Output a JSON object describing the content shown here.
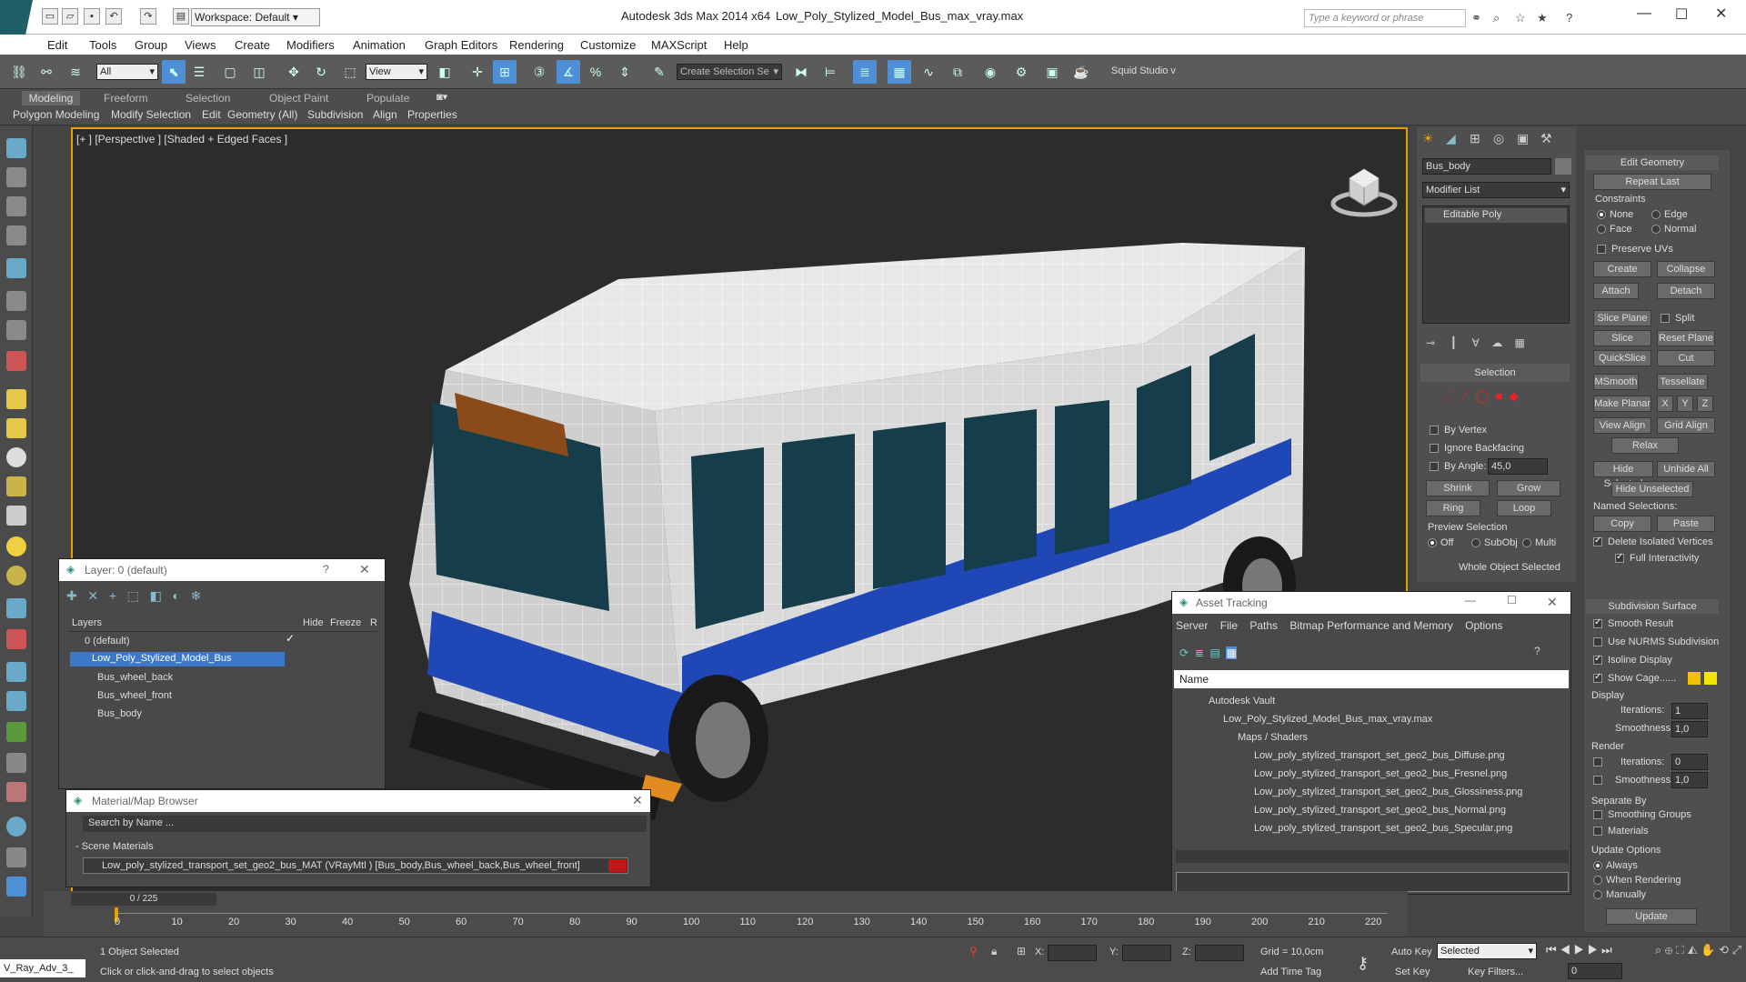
{
  "app": {
    "title": "Autodesk 3ds Max  2014 x64",
    "filename": "Low_Poly_Stylized_Model_Bus_max_vray.max",
    "workspace": "Workspace: Default",
    "search_placeholder": "Type a keyword or phrase"
  },
  "menu": [
    "Edit",
    "Tools",
    "Group",
    "Views",
    "Create",
    "Modifiers",
    "Animation",
    "Graph Editors",
    "Rendering",
    "Customize",
    "MAXScript",
    "Help"
  ],
  "toolbar": {
    "selection_filter": "All",
    "ref_coord": "View",
    "named_selection": "Create Selection Se",
    "squid": "Squid Studio v"
  },
  "ribbon": {
    "tabs": [
      "Modeling",
      "Freeform",
      "Selection",
      "Object Paint",
      "Populate"
    ],
    "subtabs": [
      "Polygon Modeling",
      "Modify Selection",
      "Edit",
      "Geometry (All)",
      "Subdivision",
      "Align",
      "Properties"
    ]
  },
  "viewport": {
    "label": "[+ ] [Perspective ] [Shaded + Edged Faces ]"
  },
  "layer_window": {
    "title": "Layer: 0 (default)",
    "columns": [
      "Layers",
      "Hide",
      "Freeze",
      "R"
    ],
    "rows": [
      "0 (default)",
      "Low_Poly_Stylized_Model_Bus",
      "Bus_wheel_back",
      "Bus_wheel_front",
      "Bus_body"
    ]
  },
  "material_browser": {
    "title": "Material/Map Browser",
    "search": "Search by Name ...",
    "section": "- Scene Materials",
    "item": "Low_poly_stylized_transport_set_geo2_bus_MAT (VRayMtl ) [Bus_body,Bus_wheel_back,Bus_wheel_front]"
  },
  "asset_tracking": {
    "title": "Asset Tracking",
    "menu": [
      "Server",
      "File",
      "Paths",
      "Bitmap Performance and Memory",
      "Options"
    ],
    "column": "Name",
    "rows": [
      "Autodesk Vault",
      "Low_Poly_Stylized_Model_Bus_max_vray.max",
      "Maps / Shaders",
      "Low_poly_stylized_transport_set_geo2_bus_Diffuse.png",
      "Low_poly_stylized_transport_set_geo2_bus_Fresnel.png",
      "Low_poly_stylized_transport_set_geo2_bus_Glossiness.png",
      "Low_poly_stylized_transport_set_geo2_bus_Normal.png",
      "Low_poly_stylized_transport_set_geo2_bus_Specular.png"
    ]
  },
  "command_panel": {
    "object_name": "Bus_body",
    "modifier_list": "Modifier List",
    "stack_item": "Editable Poly",
    "selection": {
      "title": "Selection",
      "by_vertex": "By Vertex",
      "ignore_backfacing": "Ignore Backfacing",
      "by_angle": "By Angle:",
      "angle_value": "45,0",
      "shrink": "Shrink",
      "grow": "Grow",
      "ring": "Ring",
      "loop": "Loop",
      "preview": "Preview Selection",
      "off": "Off",
      "subobj": "SubObj",
      "multi": "Multi",
      "status": "Whole Object Selected"
    },
    "edit_geometry": {
      "title": "Edit Geometry",
      "repeat_last": "Repeat Last",
      "constraints": "Constraints",
      "none": "None",
      "edge": "Edge",
      "face": "Face",
      "normal": "Normal",
      "preserve_uvs": "Preserve UVs",
      "create": "Create",
      "collapse": "Collapse",
      "attach": "Attach",
      "detach": "Detach",
      "slice_plane": "Slice Plane",
      "split": "Split",
      "slice": "Slice",
      "reset_plane": "Reset Plane",
      "quickslice": "QuickSlice",
      "cut": "Cut",
      "msmooth": "MSmooth",
      "tessellate": "Tessellate",
      "make_planar": "Make Planar",
      "x": "X",
      "y": "Y",
      "z": "Z",
      "view_align": "View Align",
      "grid_align": "Grid Align",
      "relax": "Relax",
      "hide_selected": "Hide Selected",
      "unhide_all": "Unhide All",
      "hide_unselected": "Hide Unselected",
      "named_selections": "Named Selections:",
      "copy": "Copy",
      "paste": "Paste",
      "delete_isolated": "Delete Isolated Vertices",
      "full_interactivity": "Full Interactivity"
    },
    "subdivision": {
      "title": "Subdivision Surface",
      "smooth_result": "Smooth Result",
      "use_nurms": "Use NURMS Subdivision",
      "isoline": "Isoline Display",
      "show_cage": "Show Cage......",
      "display": "Display",
      "iterations": "Iterations:",
      "iter_val": "1",
      "smoothness": "Smoothness:",
      "smooth_val": "1,0",
      "render": "Render",
      "r_iter_val": "0",
      "r_smooth_val": "1,0",
      "separate_by": "Separate By",
      "smoothing_groups": "Smoothing Groups",
      "materials": "Materials",
      "update_options": "Update Options",
      "always": "Always",
      "when_rendering": "When Rendering",
      "manually": "Manually",
      "update": "Update"
    }
  },
  "timeline": {
    "frame": "0 / 225",
    "ticks": [
      "0",
      "10",
      "20",
      "30",
      "40",
      "50",
      "60",
      "70",
      "80",
      "90",
      "100",
      "110",
      "120",
      "130",
      "140",
      "150",
      "160",
      "170",
      "180",
      "190",
      "200",
      "210",
      "220"
    ]
  },
  "status": {
    "script": "V_Ray_Adv_3_",
    "selected": "1 Object Selected",
    "prompt": "Click or click-and-drag to select objects",
    "x": "X:",
    "y": "Y:",
    "z": "Z:",
    "grid": "Grid = 10,0cm",
    "add_time_tag": "Add Time Tag",
    "auto_key": "Auto Key",
    "set_key": "Set Key",
    "key_mode": "Selected",
    "key_filters": "Key Filters...",
    "frame_val": "0"
  },
  "colors": {
    "accent": "#3b78c9",
    "bus_blue": "#1f47b5",
    "viewport_border": "#e6a000"
  }
}
